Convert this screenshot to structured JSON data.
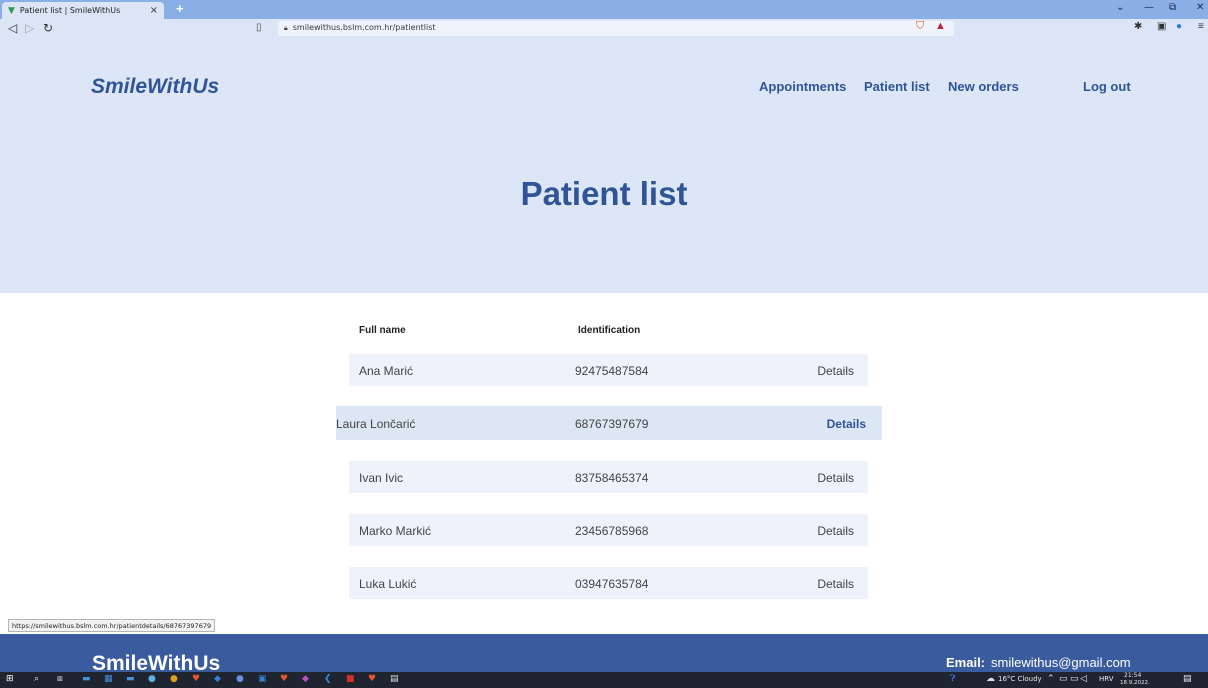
{
  "browser": {
    "tab_title": "Patient list | SmileWithUs",
    "tab_close": "×",
    "new_tab": "+",
    "url": "smilewithus.bslm.com.hr/patientlist",
    "status_url": "https://smilewithus.bslm.com.hr/patientdetails/68767397679"
  },
  "site": {
    "logo": "SmileWithUs",
    "nav": {
      "appointments": "Appointments",
      "patient_list": "Patient list",
      "new_orders": "New orders",
      "log_out": "Log out"
    },
    "page_title": "Patient list"
  },
  "table": {
    "headers": {
      "name": "Full name",
      "identification": "Identification"
    },
    "rows": [
      {
        "name": "Ana Marić",
        "id": "92475487584",
        "action": "Details"
      },
      {
        "name": "Laura Lončarić",
        "id": "68767397679",
        "action": "Details"
      },
      {
        "name": "Ivan Ivic",
        "id": "83758465374",
        "action": "Details"
      },
      {
        "name": "Marko Markić",
        "id": "23456785968",
        "action": "Details"
      },
      {
        "name": "Luka Lukić",
        "id": "03947635784",
        "action": "Details"
      }
    ]
  },
  "footer": {
    "logo": "SmileWithUs",
    "email_label": "Email:",
    "email": "smilewithus@gmail.com"
  },
  "taskbar": {
    "weather": "16°C  Cloudy",
    "language": "HRV",
    "time": "21:54",
    "date": "18.9.2022."
  },
  "colors": {
    "brand": "#2f5597",
    "hero_bg": "#dce6f6",
    "row_bg": "#edf2fb",
    "footer_bg": "#3a5b9e"
  }
}
